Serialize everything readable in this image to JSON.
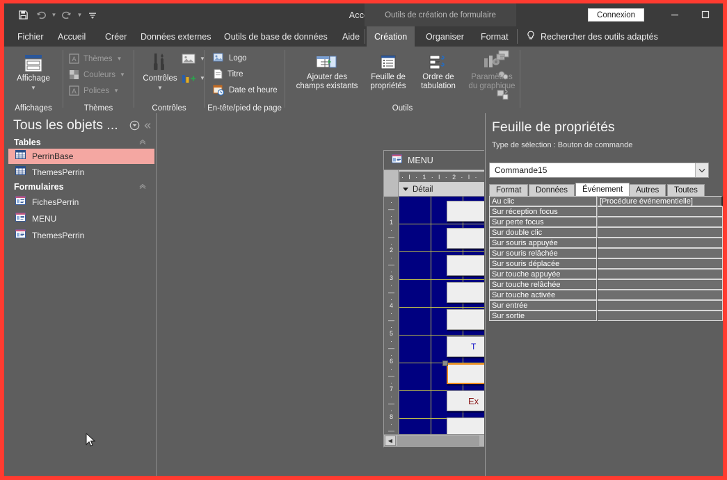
{
  "window": {
    "app_title": "Access",
    "contextual_banner": "Outils de création de formulaire",
    "connexion_label": "Connexion",
    "minimize_icon": "minimize-icon",
    "maximize_icon": "maximize-icon",
    "border_color": "#ff3b30"
  },
  "qat": {
    "save_icon": "save-icon",
    "undo_icon": "undo-icon",
    "redo_icon": "redo-icon",
    "customize_icon": "customize-quick-access-icon"
  },
  "tabs": [
    {
      "label": "Fichier",
      "active": false
    },
    {
      "label": "Accueil",
      "active": false
    },
    {
      "label": "Créer",
      "active": false
    },
    {
      "label": "Données externes",
      "active": false
    },
    {
      "label": "Outils de base de données",
      "active": false
    },
    {
      "label": "Aide",
      "active": false
    },
    {
      "label": "Création",
      "active": true
    },
    {
      "label": "Organiser",
      "active": false
    },
    {
      "label": "Format",
      "active": false
    }
  ],
  "tellme": {
    "label": "Rechercher des outils adaptés",
    "icon": "lightbulb-icon"
  },
  "ribbon": {
    "groups": [
      {
        "name": "Affichages",
        "buttons": [
          {
            "label": "Affichage",
            "icon": "view-icon",
            "has_caret": true
          }
        ]
      },
      {
        "name": "Thèmes",
        "items": [
          {
            "label": "Thèmes",
            "icon": "themes-icon",
            "disabled": true,
            "has_caret": true
          },
          {
            "label": "Couleurs",
            "icon": "colors-icon",
            "disabled": true,
            "has_caret": true
          },
          {
            "label": "Polices",
            "icon": "fonts-icon",
            "disabled": true,
            "has_caret": true
          }
        ]
      },
      {
        "name": "Contrôles",
        "buttons": [
          {
            "label": "Contrôles",
            "icon": "controls-tools-icon",
            "has_caret": true
          }
        ],
        "extras": [
          {
            "icon": "insert-image-icon",
            "has_caret": true
          },
          {
            "icon": "insert-chart-icon",
            "has_caret": true
          }
        ]
      },
      {
        "name": "En-tête/pied de page",
        "items": [
          {
            "label": "Logo",
            "icon": "logo-icon"
          },
          {
            "label": "Titre",
            "icon": "title-icon"
          },
          {
            "label": "Date et heure",
            "icon": "date-time-icon"
          }
        ]
      },
      {
        "name": "Outils",
        "buttons": [
          {
            "label": "Ajouter des\nchamps existants",
            "line1": "Ajouter des",
            "line2": "champs existants",
            "icon": "add-existing-fields-icon",
            "disabled": false
          },
          {
            "label": "Feuille de\npropriétés",
            "line1": "Feuille de",
            "line2": "propriétés",
            "icon": "property-sheet-icon",
            "disabled": false
          },
          {
            "label": "Ordre de\ntabulation",
            "line1": "Ordre de",
            "line2": "tabulation",
            "icon": "tab-order-icon",
            "disabled": false
          },
          {
            "label": "Paramètres\ndu graphique",
            "line1": "Paramètres",
            "line2": "du graphique",
            "icon": "chart-settings-icon",
            "disabled": true
          }
        ],
        "small_icons": [
          {
            "icon": "subform-in-new-window-icon",
            "disabled": true
          },
          {
            "icon": "view-code-icon",
            "disabled": true
          },
          {
            "icon": "convert-macros-icon",
            "disabled": true
          }
        ]
      }
    ]
  },
  "navpane": {
    "title": "Tous les objets ...",
    "dropdown_icon": "chevron-down-circle-icon",
    "collapse_icon": "collapse-double-chevron-icon",
    "groups": [
      {
        "name": "Tables",
        "chevron_icon": "chevron-up-icon",
        "items": [
          {
            "label": "PerrinBase",
            "icon": "table-icon",
            "selected": true
          },
          {
            "label": "ThemesPerrin",
            "icon": "table-icon",
            "selected": false
          }
        ]
      },
      {
        "name": "Formulaires",
        "chevron_icon": "chevron-up-icon",
        "items": [
          {
            "label": "FichesPerrin",
            "icon": "form-icon",
            "selected": false
          },
          {
            "label": "MENU",
            "icon": "form-icon",
            "selected": false
          },
          {
            "label": "ThemesPerrin",
            "icon": "form-icon",
            "selected": false
          }
        ]
      }
    ]
  },
  "design": {
    "form_tab_label": "MENU",
    "form_tab_icon": "form-icon",
    "section_label": "Détail",
    "section_collapse_icon": "section-collapse-icon",
    "h_ruler_text": "·  I  ·  1  ·  I  ·  2  ·  I  ·",
    "v_ruler_ticks": [
      "1",
      "2",
      "3",
      "4",
      "5",
      "6",
      "7",
      "8"
    ],
    "canvas_bg_color": "#000080",
    "grid_color": "#b9b94a",
    "scroll_left_icon": "scroll-left-arrow-icon",
    "buttons": [
      {
        "label": "",
        "selected": false
      },
      {
        "label": "",
        "selected": false
      },
      {
        "label": "",
        "selected": false
      },
      {
        "label": "",
        "selected": false
      },
      {
        "label": "",
        "selected": false
      },
      {
        "label": "T",
        "selected": false,
        "color": "#1414c8"
      },
      {
        "label": "",
        "selected": true
      },
      {
        "label": "Ex",
        "selected": false,
        "color": "#8b1a1a"
      },
      {
        "label": "",
        "selected": false
      }
    ]
  },
  "propsheet": {
    "title": "Feuille de propriétés",
    "selection_type_label": "Type de sélection :  Bouton de commande",
    "object_name": "Commande15",
    "dropdown_icon": "chevron-down-icon",
    "tabs": [
      {
        "label": "Format",
        "active": false
      },
      {
        "label": "Données",
        "active": false
      },
      {
        "label": "Événement",
        "active": true
      },
      {
        "label": "Autres",
        "active": false
      },
      {
        "label": "Toutes",
        "active": false
      }
    ],
    "rows": [
      {
        "name": "Au clic",
        "value": "[Procédure événementielle]"
      },
      {
        "name": "Sur réception focus",
        "value": ""
      },
      {
        "name": "Sur perte focus",
        "value": ""
      },
      {
        "name": "Sur double clic",
        "value": ""
      },
      {
        "name": "Sur souris appuyée",
        "value": ""
      },
      {
        "name": "Sur souris relâchée",
        "value": ""
      },
      {
        "name": "Sur souris déplacée",
        "value": ""
      },
      {
        "name": "Sur touche appuyée",
        "value": ""
      },
      {
        "name": "Sur touche relâchée",
        "value": ""
      },
      {
        "name": "Sur touche activée",
        "value": ""
      },
      {
        "name": "Sur entrée",
        "value": ""
      },
      {
        "name": "Sur sortie",
        "value": ""
      }
    ]
  }
}
